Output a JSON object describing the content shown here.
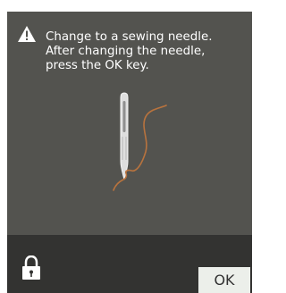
{
  "message": {
    "icon": "warning-icon",
    "lines": [
      "Change to a sewing needle.",
      "After changing the needle,",
      "press the OK key."
    ]
  },
  "illustration": {
    "name": "sewing-needle-with-thread",
    "needle_color": "#d9d9d9",
    "thread_color": "#b8733e"
  },
  "footer": {
    "lock_icon": "lock-icon",
    "ok_label": "OK"
  },
  "colors": {
    "dialog_background": "#53534f",
    "footer_background": "#333331",
    "button_background": "#ecefea",
    "text": "#ffffff"
  }
}
